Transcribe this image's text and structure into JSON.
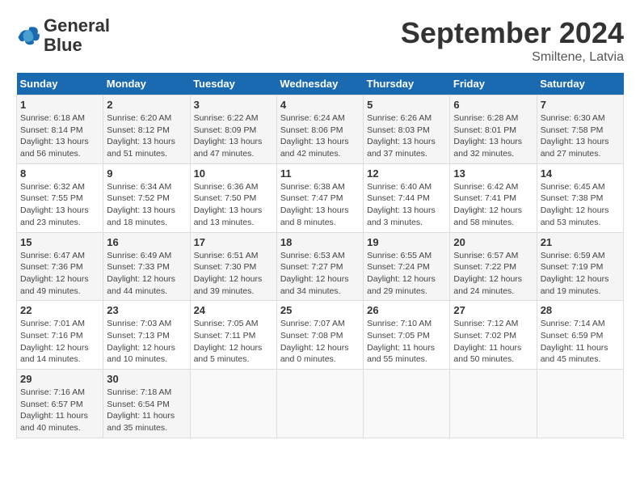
{
  "header": {
    "logo_line1": "General",
    "logo_line2": "Blue",
    "title": "September 2024",
    "subtitle": "Smiltene, Latvia"
  },
  "weekdays": [
    "Sunday",
    "Monday",
    "Tuesday",
    "Wednesday",
    "Thursday",
    "Friday",
    "Saturday"
  ],
  "weeks": [
    [
      {
        "day": "1",
        "detail": "Sunrise: 6:18 AM\nSunset: 8:14 PM\nDaylight: 13 hours\nand 56 minutes."
      },
      {
        "day": "2",
        "detail": "Sunrise: 6:20 AM\nSunset: 8:12 PM\nDaylight: 13 hours\nand 51 minutes."
      },
      {
        "day": "3",
        "detail": "Sunrise: 6:22 AM\nSunset: 8:09 PM\nDaylight: 13 hours\nand 47 minutes."
      },
      {
        "day": "4",
        "detail": "Sunrise: 6:24 AM\nSunset: 8:06 PM\nDaylight: 13 hours\nand 42 minutes."
      },
      {
        "day": "5",
        "detail": "Sunrise: 6:26 AM\nSunset: 8:03 PM\nDaylight: 13 hours\nand 37 minutes."
      },
      {
        "day": "6",
        "detail": "Sunrise: 6:28 AM\nSunset: 8:01 PM\nDaylight: 13 hours\nand 32 minutes."
      },
      {
        "day": "7",
        "detail": "Sunrise: 6:30 AM\nSunset: 7:58 PM\nDaylight: 13 hours\nand 27 minutes."
      }
    ],
    [
      {
        "day": "8",
        "detail": "Sunrise: 6:32 AM\nSunset: 7:55 PM\nDaylight: 13 hours\nand 23 minutes."
      },
      {
        "day": "9",
        "detail": "Sunrise: 6:34 AM\nSunset: 7:52 PM\nDaylight: 13 hours\nand 18 minutes."
      },
      {
        "day": "10",
        "detail": "Sunrise: 6:36 AM\nSunset: 7:50 PM\nDaylight: 13 hours\nand 13 minutes."
      },
      {
        "day": "11",
        "detail": "Sunrise: 6:38 AM\nSunset: 7:47 PM\nDaylight: 13 hours\nand 8 minutes."
      },
      {
        "day": "12",
        "detail": "Sunrise: 6:40 AM\nSunset: 7:44 PM\nDaylight: 13 hours\nand 3 minutes."
      },
      {
        "day": "13",
        "detail": "Sunrise: 6:42 AM\nSunset: 7:41 PM\nDaylight: 12 hours\nand 58 minutes."
      },
      {
        "day": "14",
        "detail": "Sunrise: 6:45 AM\nSunset: 7:38 PM\nDaylight: 12 hours\nand 53 minutes."
      }
    ],
    [
      {
        "day": "15",
        "detail": "Sunrise: 6:47 AM\nSunset: 7:36 PM\nDaylight: 12 hours\nand 49 minutes."
      },
      {
        "day": "16",
        "detail": "Sunrise: 6:49 AM\nSunset: 7:33 PM\nDaylight: 12 hours\nand 44 minutes."
      },
      {
        "day": "17",
        "detail": "Sunrise: 6:51 AM\nSunset: 7:30 PM\nDaylight: 12 hours\nand 39 minutes."
      },
      {
        "day": "18",
        "detail": "Sunrise: 6:53 AM\nSunset: 7:27 PM\nDaylight: 12 hours\nand 34 minutes."
      },
      {
        "day": "19",
        "detail": "Sunrise: 6:55 AM\nSunset: 7:24 PM\nDaylight: 12 hours\nand 29 minutes."
      },
      {
        "day": "20",
        "detail": "Sunrise: 6:57 AM\nSunset: 7:22 PM\nDaylight: 12 hours\nand 24 minutes."
      },
      {
        "day": "21",
        "detail": "Sunrise: 6:59 AM\nSunset: 7:19 PM\nDaylight: 12 hours\nand 19 minutes."
      }
    ],
    [
      {
        "day": "22",
        "detail": "Sunrise: 7:01 AM\nSunset: 7:16 PM\nDaylight: 12 hours\nand 14 minutes."
      },
      {
        "day": "23",
        "detail": "Sunrise: 7:03 AM\nSunset: 7:13 PM\nDaylight: 12 hours\nand 10 minutes."
      },
      {
        "day": "24",
        "detail": "Sunrise: 7:05 AM\nSunset: 7:11 PM\nDaylight: 12 hours\nand 5 minutes."
      },
      {
        "day": "25",
        "detail": "Sunrise: 7:07 AM\nSunset: 7:08 PM\nDaylight: 12 hours\nand 0 minutes."
      },
      {
        "day": "26",
        "detail": "Sunrise: 7:10 AM\nSunset: 7:05 PM\nDaylight: 11 hours\nand 55 minutes."
      },
      {
        "day": "27",
        "detail": "Sunrise: 7:12 AM\nSunset: 7:02 PM\nDaylight: 11 hours\nand 50 minutes."
      },
      {
        "day": "28",
        "detail": "Sunrise: 7:14 AM\nSunset: 6:59 PM\nDaylight: 11 hours\nand 45 minutes."
      }
    ],
    [
      {
        "day": "29",
        "detail": "Sunrise: 7:16 AM\nSunset: 6:57 PM\nDaylight: 11 hours\nand 40 minutes."
      },
      {
        "day": "30",
        "detail": "Sunrise: 7:18 AM\nSunset: 6:54 PM\nDaylight: 11 hours\nand 35 minutes."
      },
      {
        "day": "",
        "detail": ""
      },
      {
        "day": "",
        "detail": ""
      },
      {
        "day": "",
        "detail": ""
      },
      {
        "day": "",
        "detail": ""
      },
      {
        "day": "",
        "detail": ""
      }
    ]
  ]
}
